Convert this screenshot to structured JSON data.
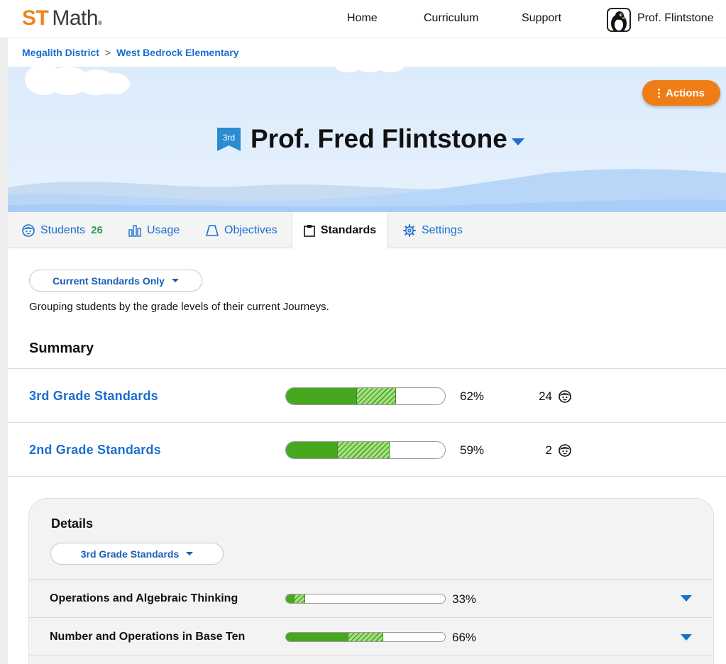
{
  "brand": {
    "logo_st": "ST",
    "logo_math": "Math",
    "logo_reg": "®"
  },
  "nav": {
    "items": [
      {
        "label": "Home"
      },
      {
        "label": "Curriculum"
      },
      {
        "label": "Support"
      }
    ],
    "user_name": "Prof. Flintstone",
    "avatar_icon": "penguin-avatar-icon"
  },
  "breadcrumb": {
    "items": [
      "Megalith District",
      "West Bedrock Elementary"
    ],
    "separator": ">"
  },
  "banner": {
    "grade_badge": "3rd",
    "teacher_name": "Prof. Fred Flintstone",
    "actions_label": "Actions"
  },
  "tabs": [
    {
      "label": "Students",
      "count": "26",
      "icon": "student-face-icon"
    },
    {
      "label": "Usage",
      "icon": "bar-chart-icon"
    },
    {
      "label": "Objectives",
      "icon": "trapezoid-icon"
    },
    {
      "label": "Standards",
      "icon": "clipboard-icon",
      "active": true
    },
    {
      "label": "Settings",
      "icon": "gear-icon"
    }
  ],
  "filter": {
    "selected": "Current Standards Only",
    "help_text": "Grouping students by the grade levels of their current Journeys."
  },
  "summary": {
    "heading": "Summary",
    "rows": [
      {
        "label": "3rd Grade Standards",
        "percent_label": "62%",
        "mastered_fraction": 0.44,
        "in_progress_fraction": 0.25,
        "students": "24"
      },
      {
        "label": "2nd Grade Standards",
        "percent_label": "59%",
        "mastered_fraction": 0.32,
        "in_progress_fraction": 0.33,
        "students": "2"
      }
    ]
  },
  "details": {
    "heading": "Details",
    "selected": "3rd Grade Standards",
    "rows": [
      {
        "label": "Operations and Algebraic Thinking",
        "percent_label": "33%",
        "mastered_fraction": 0.05,
        "in_progress_fraction": 0.07
      },
      {
        "label": "Number and Operations in Base Ten",
        "percent_label": "66%",
        "mastered_fraction": 0.39,
        "in_progress_fraction": 0.22
      }
    ]
  },
  "colors": {
    "brand_orange": "#f0831e",
    "link_blue": "#1a6fcf",
    "progress_green": "#47a71f",
    "actions_orange": "#ef7d16",
    "count_green": "#2f9a5e"
  }
}
